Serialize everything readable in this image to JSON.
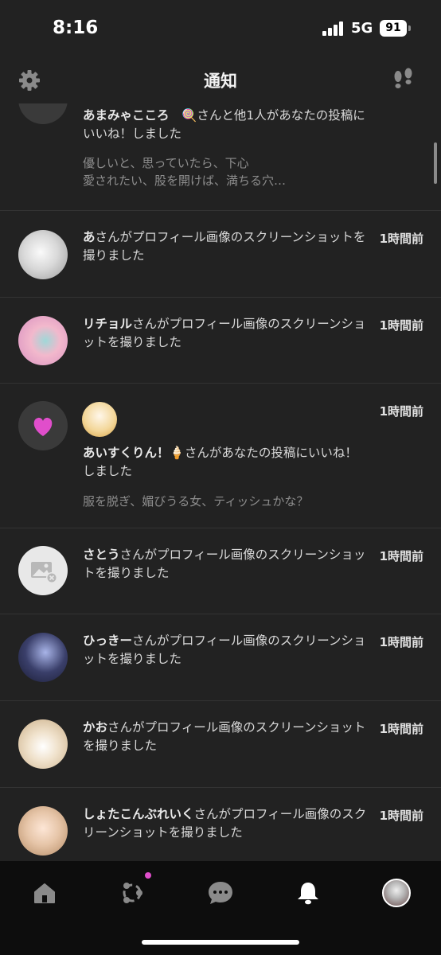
{
  "status": {
    "time": "8:16",
    "network": "5G",
    "battery": "91"
  },
  "nav": {
    "title": "通知",
    "settings_icon": "gear-icon",
    "footprint_icon": "footprints-icon"
  },
  "notifications": [
    {
      "name": "あまみゃこころ",
      "emoji": "🍭",
      "text": "さんと他1人があなたの投稿にいいね！しました",
      "preview_lines": [
        "優しいと、思っていたら、下心",
        "愛されたい、股を開けば、満ちる穴…"
      ],
      "time": ""
    },
    {
      "name": "あ",
      "text": "さんがプロフィール画像のスクリーンショットを撮りました",
      "time": "1時間前"
    },
    {
      "name": "リチョル",
      "text": "さんがプロフィール画像のスクリーンショットを撮りました",
      "time": "1時間前"
    },
    {
      "name": "あいすくりん！",
      "emoji": "🍦",
      "text": "さんがあなたの投稿にいいね！しました",
      "preview_lines": [
        "服を脱ぎ、媚びうる女、ティッシュかな？"
      ],
      "time": "1時間前"
    },
    {
      "name": "さとう",
      "text": "さんがプロフィール画像のスクリーンショットを撮りました",
      "time": "1時間前"
    },
    {
      "name": "ひっきー",
      "text": "さんがプロフィール画像のスクリーンショットを撮りました",
      "time": "1時間前"
    },
    {
      "name": "かお",
      "text": "さんがプロフィール画像のスクリーンショットを撮りました",
      "time": "1時間前"
    },
    {
      "name": "しょたこんぶれいく",
      "text": "さんがプロフィール画像のスクリーンショットを撮りました",
      "time": "1時間前"
    }
  ],
  "tabs": [
    {
      "icon": "home-icon"
    },
    {
      "icon": "share-network-icon",
      "badge": true
    },
    {
      "icon": "chat-bubble-icon"
    },
    {
      "icon": "bell-icon",
      "active": true
    },
    {
      "icon": "profile-avatar-icon"
    }
  ],
  "colors": {
    "background": "#222222",
    "tab_bar": "#0d0d0d",
    "accent_heart": "#e04ecb",
    "badge": "#e04ecb"
  }
}
